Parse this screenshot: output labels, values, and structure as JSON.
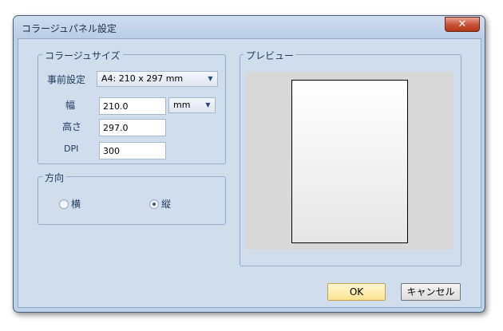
{
  "window": {
    "title": "コラージュパネル設定",
    "close_glyph": "✕"
  },
  "collage_size": {
    "legend": "コラージュサイズ",
    "preset_label": "事前設定",
    "preset_value": "A4: 210 x 297 mm",
    "width_label": "幅",
    "width_value": "210.0",
    "unit_value": "mm",
    "height_label": "高さ",
    "height_value": "297.0",
    "dpi_label": "DPI",
    "dpi_value": "300"
  },
  "orientation": {
    "legend": "方向",
    "landscape_label": "横",
    "portrait_label": "縦",
    "selected": "portrait"
  },
  "preview": {
    "legend": "プレビュー"
  },
  "buttons": {
    "ok_label": "OK",
    "cancel_label": "キャンセル"
  }
}
